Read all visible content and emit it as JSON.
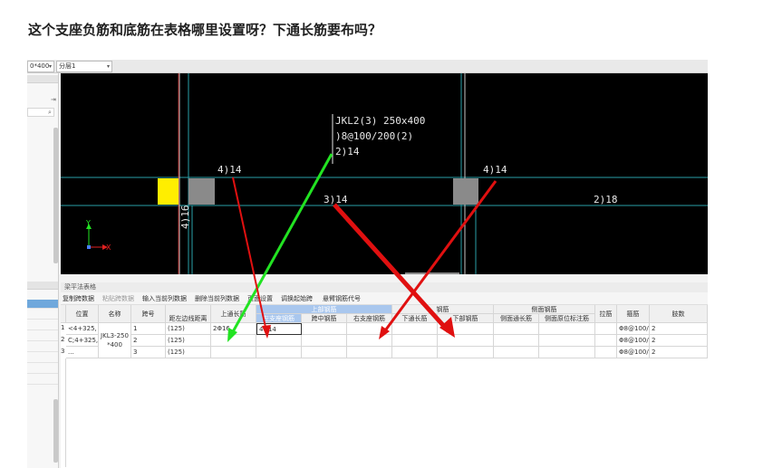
{
  "question": "这个支座负筋和底筋在表格哪里设置呀？下通长筋要布吗？",
  "topbar": {
    "section_combo": "0*400",
    "layer_combo": "分层1",
    "combo_arrow": "▾"
  },
  "cad": {
    "beam_label": "JKL2(3) 250x400",
    "stirrup": ")8@100/200(2)",
    "top_bars": "2)14",
    "left_support": "4)14",
    "right_support": "4)14",
    "mid_bottom": "3)14",
    "right_bottom": "2)18",
    "column_label": "4)16",
    "axis_x": "X",
    "axis_y": "Y"
  },
  "table_panel": {
    "title": "梁平法表格",
    "toolbar": [
      "复制跨数据",
      "粘贴跨数据",
      "输入当前列数据",
      "删除当前列数据",
      "页面设置",
      "调换起始跨",
      "悬臂钢筋代号"
    ],
    "group_headers": {
      "top_rebar": "上部钢筋",
      "bottom_rebar": "钢筋",
      "side_rebar": "侧面钢筋"
    },
    "columns": [
      "位置",
      "名称",
      "跨号",
      "距左边线距离",
      "上通长筋",
      "左支座钢筋",
      "跨中钢筋",
      "右支座钢筋",
      "下通长筋",
      "下部钢筋",
      "侧面通长筋",
      "侧面原位标注筋",
      "拉筋",
      "箍筋",
      "肢数"
    ],
    "rows": [
      {
        "num": "1",
        "position": "<4+325,",
        "span": "1",
        "offset": "(125)",
        "top_through": "2Φ16",
        "left_support": "4Φ14",
        "stirrup": "Φ8@100/",
        "legs": "2"
      },
      {
        "num": "2",
        "position": "C;4+325,",
        "span": "2",
        "offset": "(125)",
        "top_through": "",
        "left_support": "",
        "stirrup": "Φ8@100/",
        "legs": "2"
      },
      {
        "num": "3",
        "position": "...",
        "span": "3",
        "offset": "(125)",
        "top_through": "",
        "left_support": "",
        "stirrup": "Φ8@100/",
        "legs": "2"
      }
    ],
    "merged_name": [
      "JKL3-250",
      "*400"
    ]
  },
  "colors": {
    "canvas_bg": "#000000",
    "beam_line": "#2aa0a8",
    "green_arrow": "#22e322",
    "red_arrow": "#e01010",
    "header_blue": "#a9c7ee"
  }
}
